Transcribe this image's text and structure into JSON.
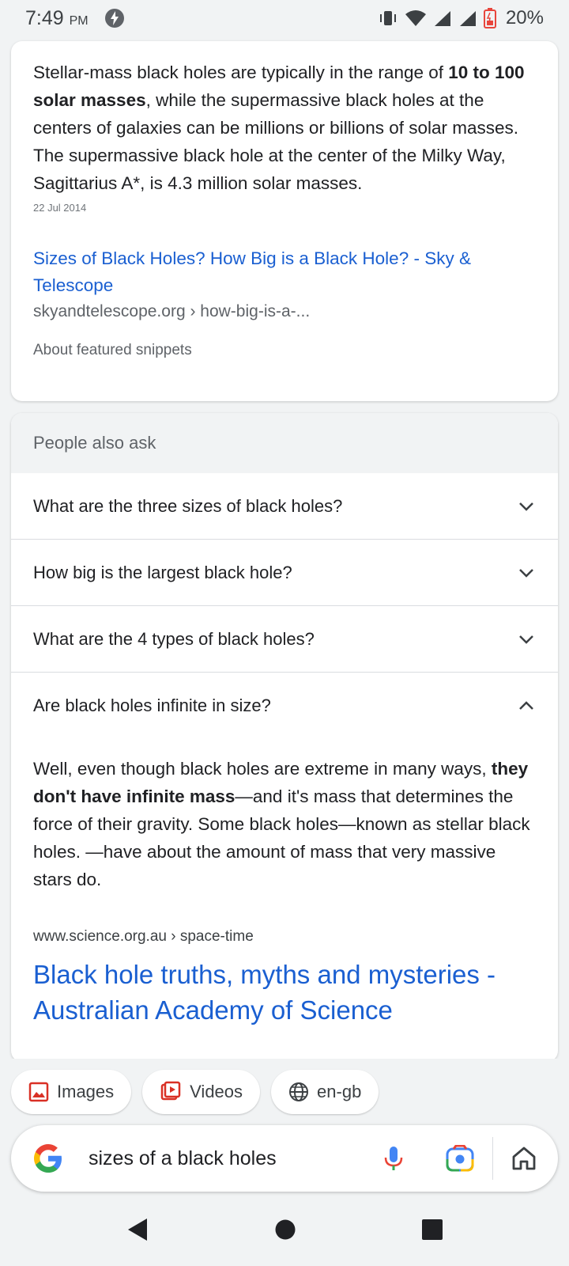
{
  "status": {
    "time": "7:49",
    "ampm": "PM",
    "battery": "20%"
  },
  "snippet": {
    "text_before": "Stellar-mass black holes are typically in the range of ",
    "text_bold": "10 to 100 solar masses",
    "text_after": ", while the supermassive black holes at the centers of galaxies can be millions or billions of solar masses. The supermassive black hole at the center of the Milky Way, Sagittarius A*, is 4.3 million solar masses.",
    "date": "22 Jul 2014",
    "link_title": "Sizes of Black Holes? How Big is a Black Hole? - Sky & Telescope",
    "link_url": "skyandtelescope.org › how-big-is-a-...",
    "about": "About featured snippets"
  },
  "paa": {
    "header": "People also ask",
    "questions": [
      "What are the three sizes of black holes?",
      "How big is the largest black hole?",
      "What are the 4 types of black holes?",
      "Are black holes infinite in size?"
    ],
    "answer": {
      "before": "Well, even though black holes are extreme in many ways, ",
      "bold": "they don't have infinite mass",
      "after": "—and it's mass that determines the force of their gravity. Some black holes—known as stellar black holes. —have about the amount of mass that very massive stars do.",
      "url": "www.science.org.au › space-time",
      "title": "Black hole truths, myths and mysteries - Australian Academy of Science"
    }
  },
  "chips": {
    "images": "Images",
    "videos": "Videos",
    "lang": "en-gb"
  },
  "search": {
    "query": "sizes of a black holes"
  },
  "colors": {
    "link": "#1a5fd1",
    "images_icon": "#d93025",
    "google_blue": "#4285f4"
  }
}
